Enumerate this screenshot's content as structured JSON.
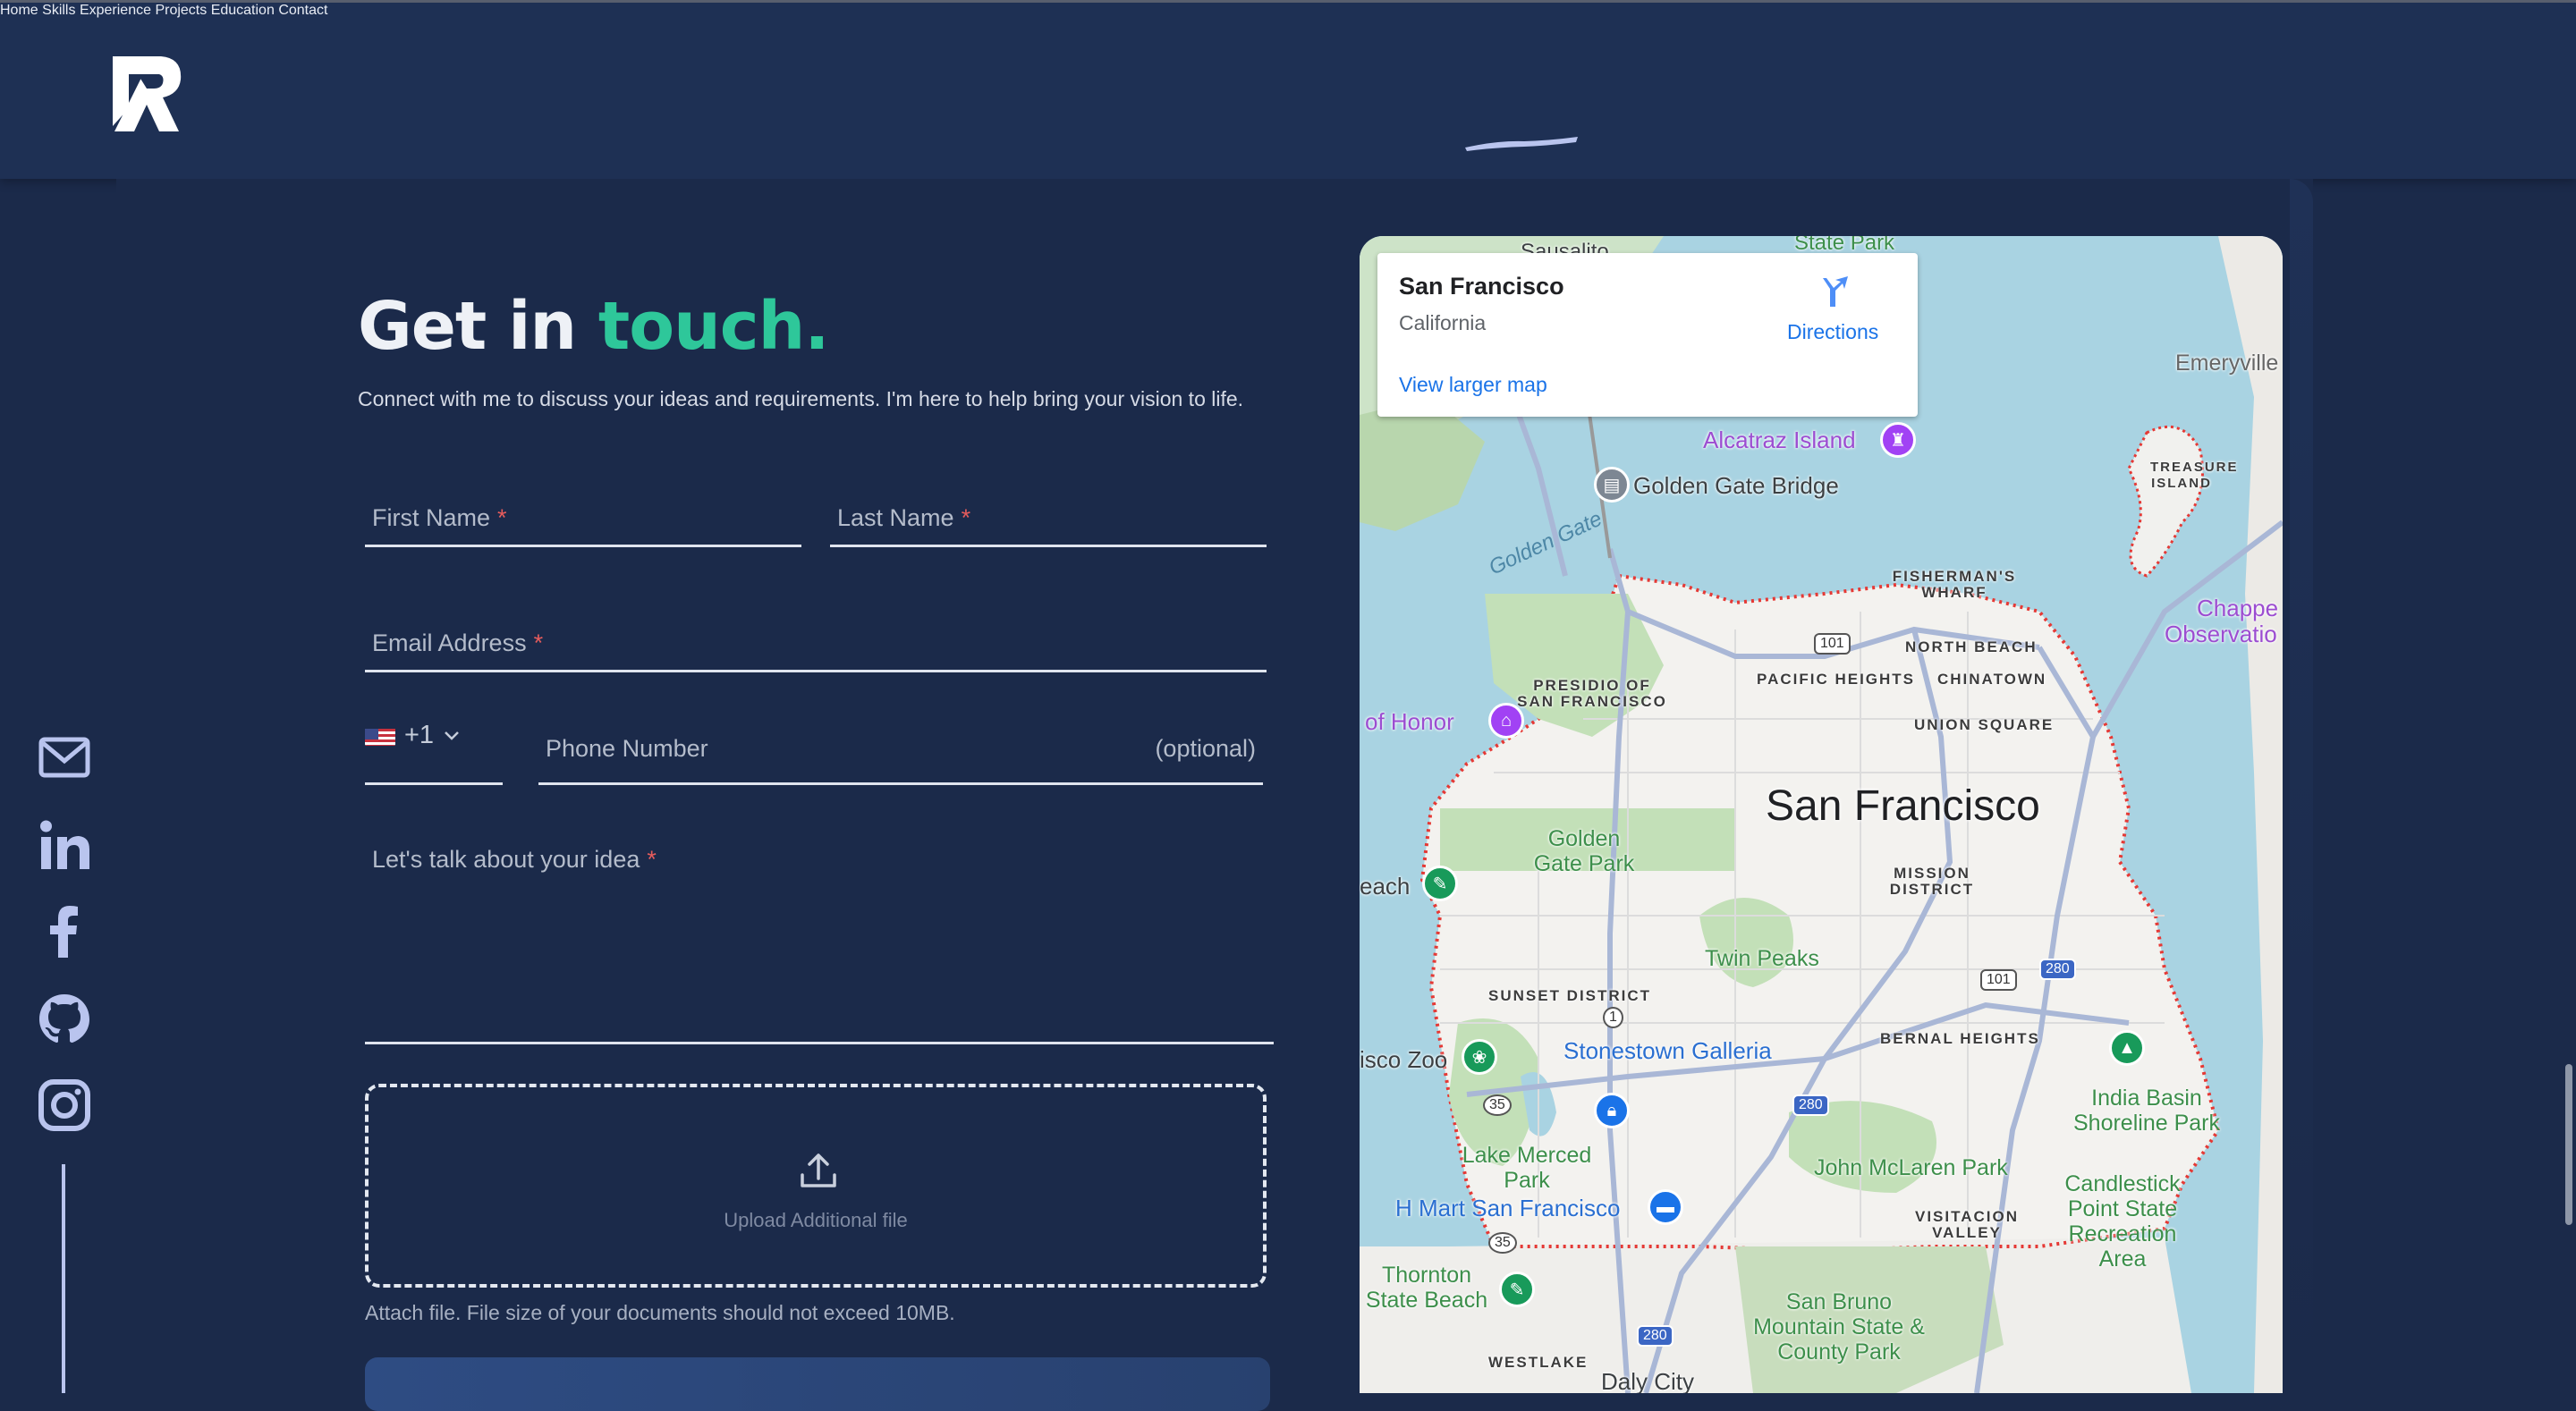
{
  "nav": {
    "items": [
      "Home",
      "Skills",
      "Experience",
      "Projects",
      "Education",
      "Contact"
    ],
    "active": "Home"
  },
  "logo_icon": "brand-logo-icon",
  "social_icons": [
    "mail-icon",
    "linkedin-icon",
    "facebook-icon",
    "github-icon",
    "instagram-icon"
  ],
  "contact": {
    "title_part1": "Get in",
    "title_part2": "touch.",
    "subtitle": "Connect with me to discuss your ideas and requirements. I'm here to help bring your vision to life.",
    "first_name_label": "First Name",
    "last_name_label": "Last Name",
    "email_label": "Email Address",
    "phone_code": "+1",
    "phone_label": "Phone Number",
    "phone_optional": "(optional)",
    "idea_label": "Let's talk about your idea",
    "required_marker": "*",
    "upload_text": "Upload Additional file",
    "attach_note": "Attach file. File size of your documents should not exceed 10MB."
  },
  "map": {
    "card": {
      "place": "San Francisco",
      "region": "California",
      "directions": "Directions",
      "larger_map": "View larger map"
    },
    "labels": {
      "city": "San Francisco",
      "sausalito": "Sausalito",
      "state_park": "State Park",
      "emeryville": "Emeryville",
      "alcatraz": "Alcatraz Island",
      "golden_gate_bridge": "Golden Gate Bridge",
      "golden_gate": "Golden Gate",
      "treasure_island": "TREASURE ISLAND",
      "fishermans_wharf": "FISHERMAN'S WHARF",
      "north_beach": "NORTH BEACH",
      "pacific_heights": "PACIFIC HEIGHTS",
      "chinatown": "CHINATOWN",
      "presidio": "PRESIDIO OF SAN FRANCISCO",
      "legion_of_honor": "of Honor",
      "union_square": "UNION SQUARE",
      "chapel": "Chappe",
      "observation": "Observatio",
      "golden_gate_park": "Golden Gate Park",
      "beach": "each",
      "mission": "MISSION DISTRICT",
      "twin_peaks": "Twin Peaks",
      "sunset": "SUNSET DISTRICT",
      "stonestown": "Stonestown Galleria",
      "bernal": "BERNAL HEIGHTS",
      "zoo": "isco Zoo",
      "india_basin": "India Basin Shoreline Park",
      "lake_merced": "Lake Merced Park",
      "john_mclaren": "John McLaren Park",
      "hmart": "H Mart San Francisco",
      "candlestick": "Candlestick Point State Recreation Area",
      "visitacion": "VISITACION VALLEY",
      "thornton": "Thornton State Beach",
      "san_bruno": "San Bruno Mountain State & County Park",
      "westlake": "WESTLAKE",
      "daly_city": "Daly City"
    },
    "shields": {
      "us101_a": "101",
      "us101_b": "101",
      "i280_a": "280",
      "i280_b": "280",
      "i280_c": "280",
      "ca1": "1",
      "ca35_a": "35",
      "ca35_b": "35"
    }
  },
  "colors": {
    "background": "#1b2a4a",
    "navbar": "#1e3054",
    "accent_green": "#2ec79a",
    "required_red": "#e65c5c",
    "underline_lilac": "#b9c4ee"
  }
}
